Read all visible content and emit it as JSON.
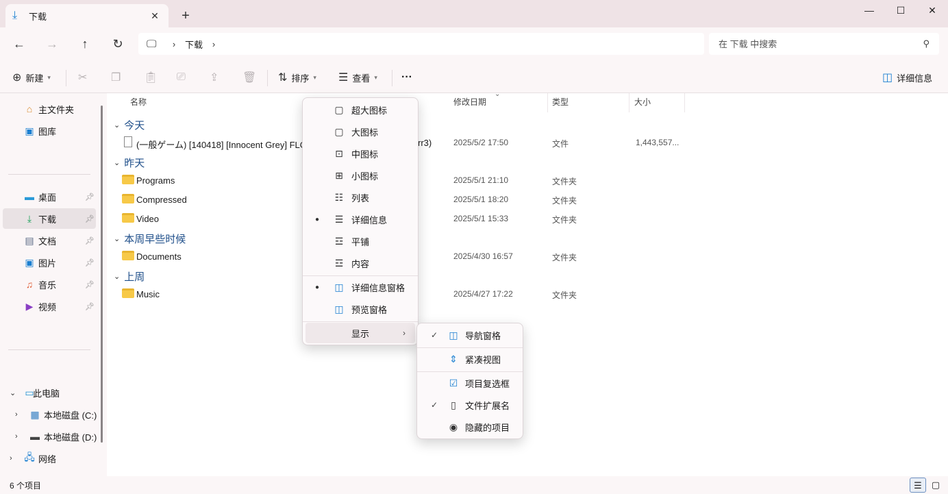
{
  "tab": {
    "title": "下载"
  },
  "address": {
    "crumb": "下载",
    "search_placeholder": "在 下载 中搜索"
  },
  "toolbar": {
    "new": "新建",
    "sort": "排序",
    "view": "查看",
    "more": "···",
    "details": "详细信息"
  },
  "sidebar": {
    "home": "主文件夹",
    "gallery": "图库",
    "desktop": "桌面",
    "downloads": "下载",
    "documents": "文档",
    "pictures": "图片",
    "music": "音乐",
    "videos": "视频",
    "thispc": "此电脑",
    "drive_c": "本地磁盘 (C:)",
    "drive_d": "本地磁盘 (D:)",
    "network": "网络"
  },
  "columns": {
    "name": "名称",
    "date": "修改日期",
    "type": "类型",
    "size": "大小"
  },
  "groups": {
    "today": "今天",
    "yesterday": "昨天",
    "earlier_week": "本周早些时候",
    "last_week": "上周"
  },
  "rows": [
    {
      "name": "(一般ゲーム) [140418] [Innocent Grey] FLO",
      "name_tail": "rr3)",
      "date": "2025/5/2 17:50",
      "type": "文件",
      "size": "1,443,557..."
    },
    {
      "name": "Programs",
      "date": "2025/5/1 21:10",
      "type": "文件夹",
      "size": ""
    },
    {
      "name": "Compressed",
      "date": "2025/5/1 18:20",
      "type": "文件夹",
      "size": ""
    },
    {
      "name": "Video",
      "date": "2025/5/1 15:33",
      "type": "文件夹",
      "size": ""
    },
    {
      "name": "Documents",
      "date": "2025/4/30 16:57",
      "type": "文件夹",
      "size": ""
    },
    {
      "name": "Music",
      "date": "2025/4/27 17:22",
      "type": "文件夹",
      "size": ""
    }
  ],
  "view_menu": {
    "xl_icons": "超大图标",
    "l_icons": "大图标",
    "m_icons": "中图标",
    "s_icons": "小图标",
    "list": "列表",
    "details": "详细信息",
    "tiles": "平铺",
    "content": "内容",
    "details_pane": "详细信息窗格",
    "preview_pane": "预览窗格",
    "show": "显示"
  },
  "show_menu": {
    "nav_pane": "导航窗格",
    "compact": "紧凑视图",
    "checkboxes": "项目复选框",
    "extensions": "文件扩展名",
    "hidden": "隐藏的项目"
  },
  "status": {
    "count": "6 个项目"
  },
  "colors": {
    "accent": "#1a7fd1",
    "folder": "#f7c948",
    "group_text": "#1f4f8a"
  }
}
